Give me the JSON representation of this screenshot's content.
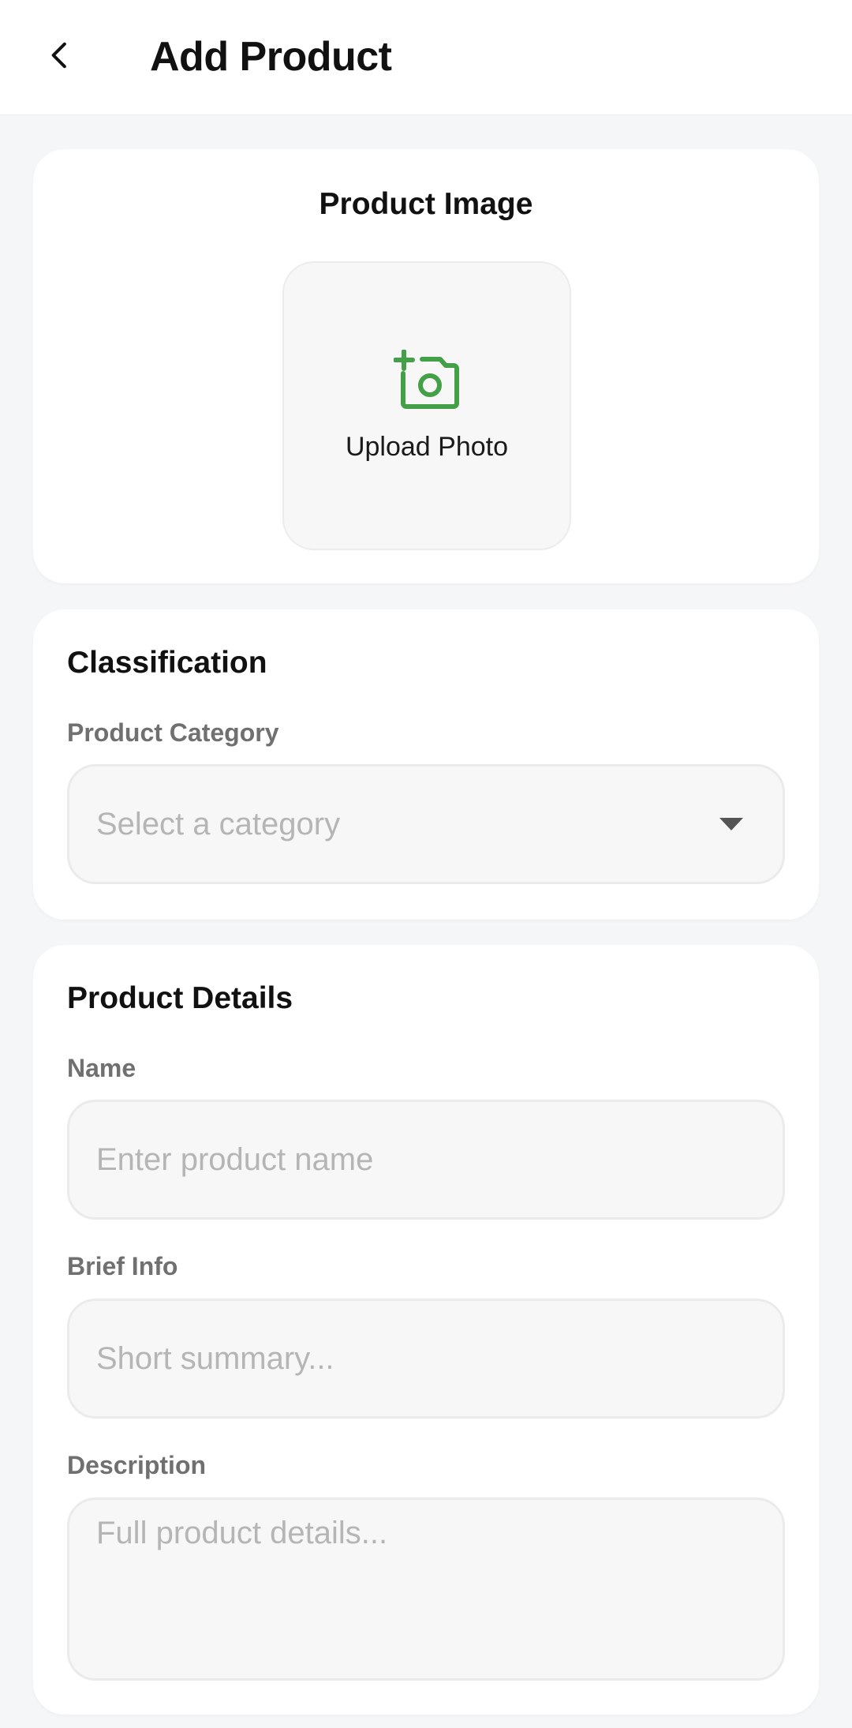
{
  "header": {
    "title": "Add Product",
    "back_icon": "chevron-left-icon"
  },
  "image_section": {
    "title": "Product Image",
    "upload_label": "Upload Photo",
    "upload_icon": "add-a-photo-icon",
    "accent_color": "#43a047"
  },
  "classification": {
    "title": "Classification",
    "category_label": "Product Category",
    "category_placeholder": "Select a category",
    "dropdown_icon": "caret-down-icon"
  },
  "details": {
    "title": "Product Details",
    "name_label": "Name",
    "name_placeholder": "Enter product name",
    "brief_label": "Brief Info",
    "brief_placeholder": "Short summary...",
    "description_label": "Description",
    "description_placeholder": "Full product details..."
  },
  "colors": {
    "background": "#f5f6f8",
    "card": "#ffffff",
    "input_fill": "#f7f7f7",
    "label_gray": "#707070",
    "placeholder_gray": "#b5b5b5"
  }
}
